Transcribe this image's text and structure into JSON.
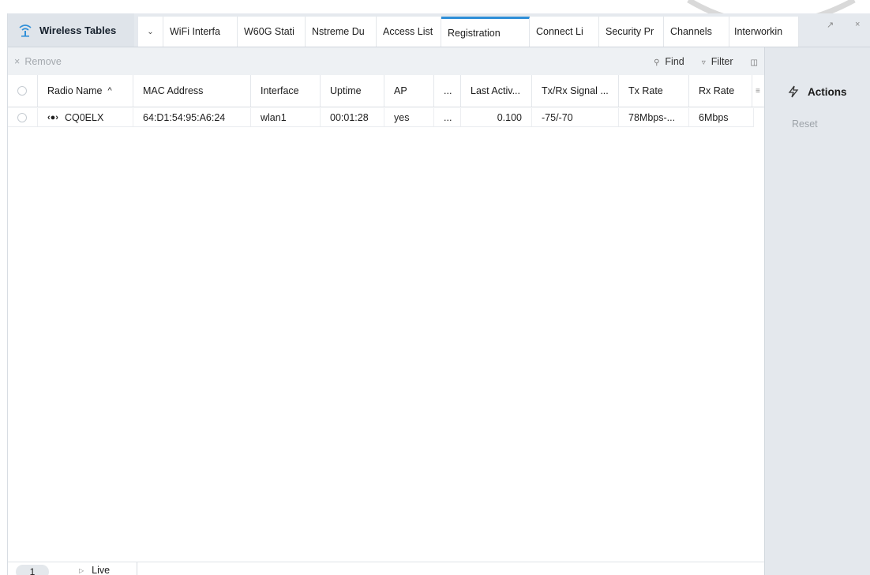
{
  "window": {
    "title": "Wireless Tables"
  },
  "tabs": [
    {
      "label": "WiFi Interfa",
      "active": false
    },
    {
      "label": "W60G Stati",
      "active": false
    },
    {
      "label": "Nstreme Du",
      "active": false
    },
    {
      "label": "Access List",
      "active": false
    },
    {
      "label": "Registration",
      "active": true
    },
    {
      "label": "Connect Li",
      "active": false
    },
    {
      "label": "Security Pr",
      "active": false
    },
    {
      "label": "Channels",
      "active": false
    },
    {
      "label": "Interworkin",
      "active": false
    }
  ],
  "toolbar": {
    "remove": "Remove",
    "find": "Find",
    "filter": "Filter"
  },
  "table": {
    "columns": [
      "Radio Name",
      "MAC Address",
      "Interface",
      "Uptime",
      "AP",
      "...",
      "Last Activ...",
      "Tx/Rx Signal ...",
      "Tx Rate",
      "Rx Rate"
    ],
    "sort_indicator": "^",
    "rows": [
      {
        "radio_name": "CQ0ELX",
        "mac": "64:D1:54:95:A6:24",
        "interface": "wlan1",
        "uptime": "00:01:28",
        "ap": "yes",
        "more": "...",
        "last_activity": "0.100",
        "signal": "-75/-70",
        "tx_rate": "78Mbps-...",
        "rx_rate": "6Mbps"
      }
    ]
  },
  "sidebar": {
    "title": "Actions",
    "reset": "Reset"
  },
  "footer": {
    "page": "1",
    "live": "Live"
  },
  "colors": {
    "accent": "#2f8fd8",
    "tabbar": "#e5e9ee",
    "sidebar": "#e4e8ed"
  }
}
